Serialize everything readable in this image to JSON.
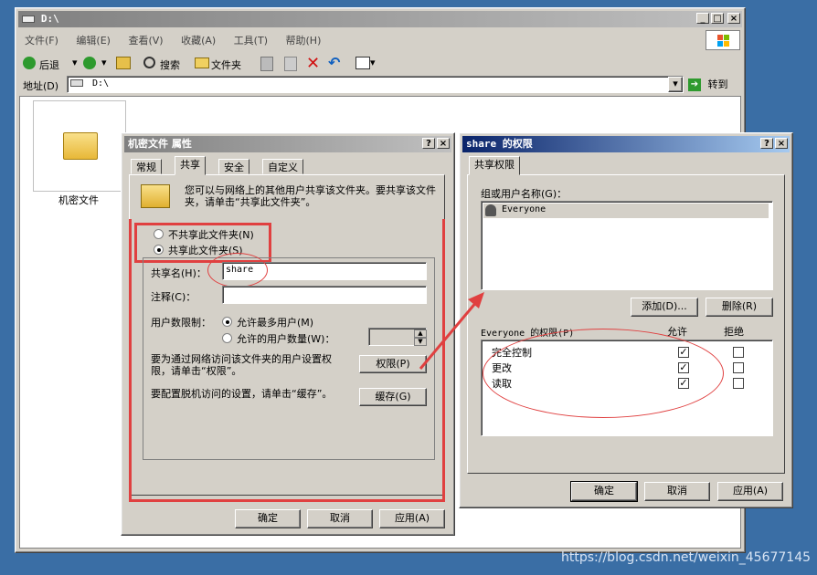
{
  "explorer": {
    "title": "D:\\",
    "menu": [
      "文件(F)",
      "编辑(E)",
      "查看(V)",
      "收藏(A)",
      "工具(T)",
      "帮助(H)"
    ],
    "toolbar": {
      "back": "后退",
      "search": "搜索",
      "folders": "文件夹"
    },
    "address_label": "地址(D)",
    "address_value": "D:\\",
    "go": "转到",
    "folder_name": "机密文件"
  },
  "props": {
    "title": "机密文件 属性",
    "tabs": [
      "常规",
      "共享",
      "安全",
      "自定义"
    ],
    "info": "您可以与网络上的其他用户共享该文件夹。要共享该文件夹，请单击“共享此文件夹”。",
    "no_share": "不共享此文件夹(N)",
    "share": "共享此文件夹(S)",
    "share_name_label": "共享名(H)：",
    "share_name_value": "share",
    "comment_label": "注释(C)：",
    "user_limit_label": "用户数限制：",
    "max_users": "允许最多用户(M)",
    "allow_users": "允许的用户数量(W)：",
    "perm_text": "要为通过网络访问该文件夹的用户设置权限，请单击“权限”。",
    "perm_btn": "权限(P)",
    "cache_text": "要配置脱机访问的设置，请单击“缓存”。",
    "cache_btn": "缓存(G)",
    "ok": "确定",
    "cancel": "取消",
    "apply": "应用(A)"
  },
  "perm": {
    "title": "share 的权限",
    "tab": "共享权限",
    "group_label": "组或用户名称(G)：",
    "users": [
      "Everyone"
    ],
    "add": "添加(D)...",
    "remove": "删除(R)",
    "perm_for": "Everyone 的权限(P)",
    "allow": "允许",
    "deny": "拒绝",
    "rows": [
      {
        "name": "完全控制",
        "allow": true,
        "deny": false
      },
      {
        "name": "更改",
        "allow": true,
        "deny": false
      },
      {
        "name": "读取",
        "allow": true,
        "deny": false
      }
    ],
    "ok": "确定",
    "cancel": "取消",
    "apply": "应用(A)"
  },
  "watermark": "https://blog.csdn.net/weixin_45677145",
  "colors": {
    "highlight": "#e04040",
    "title_active": "#0a246a",
    "face": "#d4d0c8"
  }
}
